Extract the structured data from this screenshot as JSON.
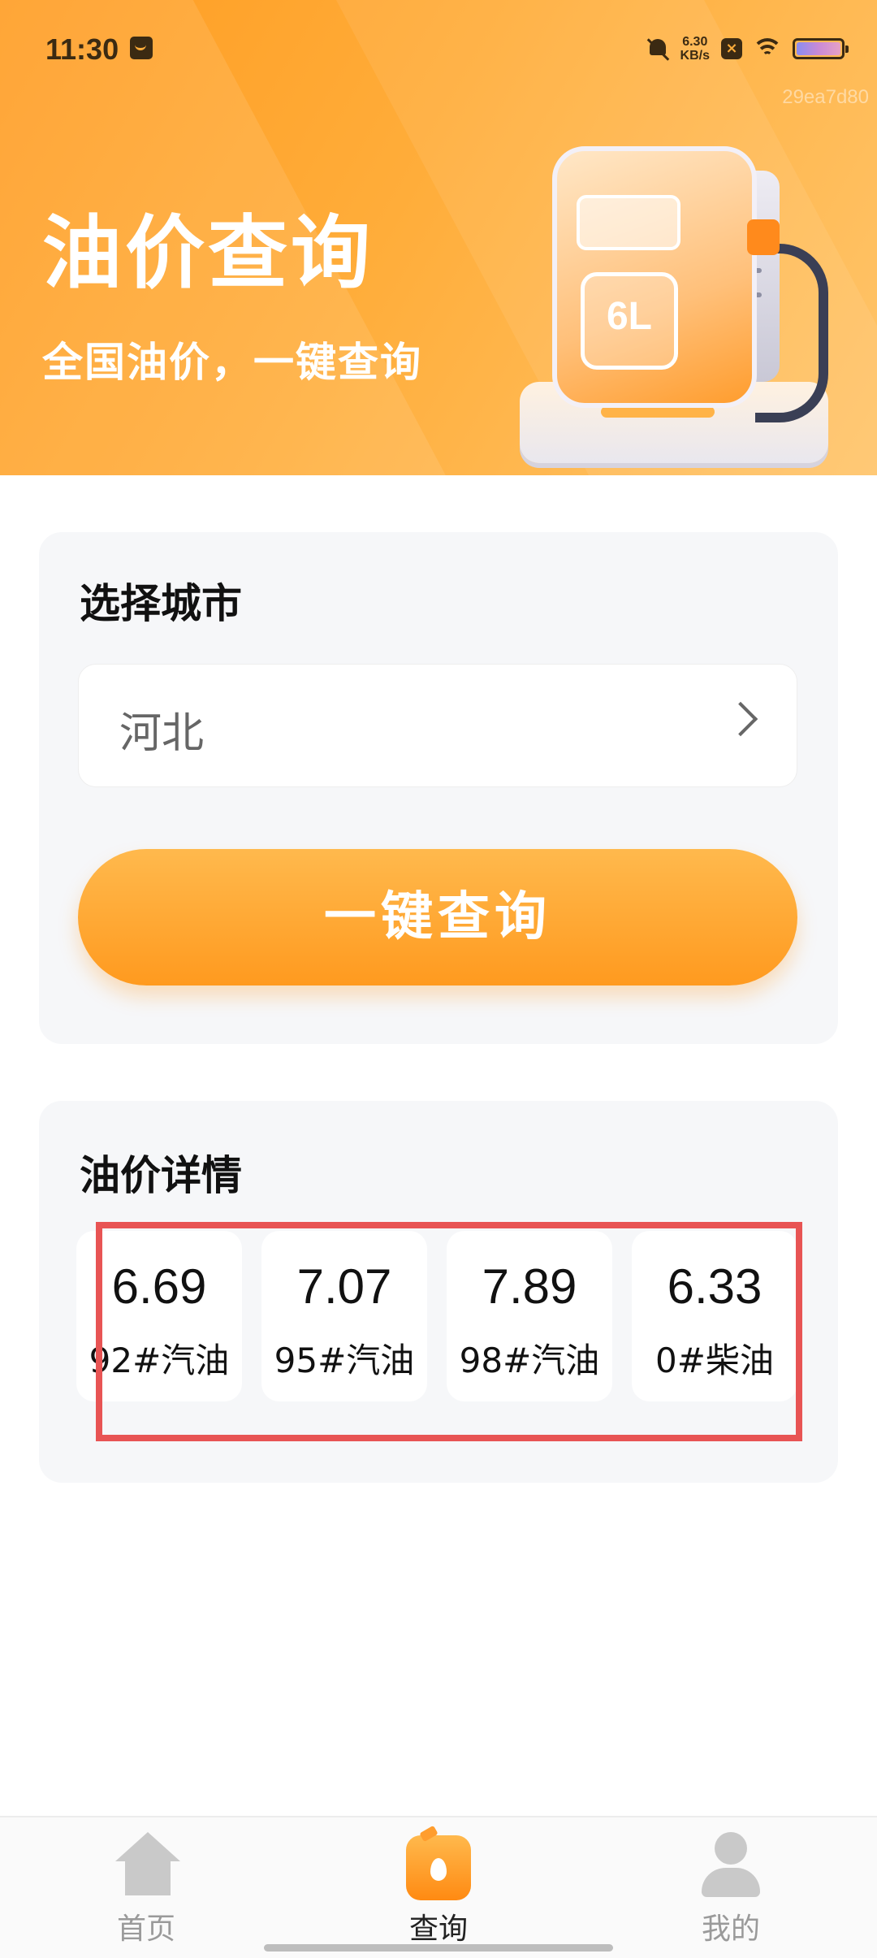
{
  "status_bar": {
    "time": "11:30",
    "net_speed_value": "6.30",
    "net_speed_unit": "KB/s",
    "icons": [
      "message-icon",
      "bell-off-icon",
      "close-icon",
      "wifi-icon",
      "battery-icon"
    ]
  },
  "watermark": "29ea7d80",
  "header": {
    "title": "油价查询",
    "subtitle": "全国油价，一键查询",
    "pump_tag": "6L"
  },
  "city_card": {
    "title": "选择城市",
    "selected_city": "河北",
    "query_button": "一键查询"
  },
  "detail_card": {
    "title": "油价详情",
    "prices": [
      {
        "value": "6.69",
        "label": "92#汽油"
      },
      {
        "value": "7.07",
        "label": "95#汽油"
      },
      {
        "value": "7.89",
        "label": "98#汽油"
      },
      {
        "value": "6.33",
        "label": "0#柴油"
      }
    ]
  },
  "bottom_nav": {
    "items": [
      {
        "label": "首页",
        "icon": "home-icon",
        "active": false
      },
      {
        "label": "查询",
        "icon": "fuel-search-icon",
        "active": true
      },
      {
        "label": "我的",
        "icon": "profile-icon",
        "active": false
      }
    ]
  },
  "colors": {
    "brand_orange": "#ff9a1f",
    "highlight_red": "#e85454"
  }
}
